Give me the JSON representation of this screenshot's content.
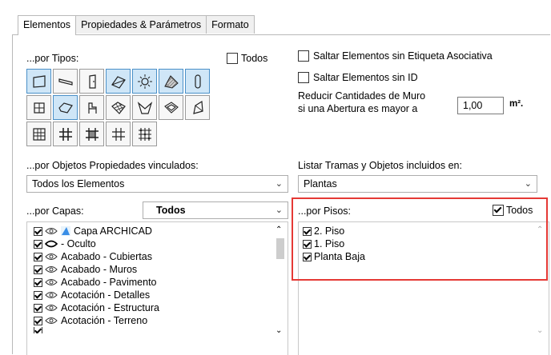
{
  "tabs": [
    "Elementos",
    "Propiedades & Parámetros",
    "Formato"
  ],
  "by_types": {
    "label": "...por Tipos:",
    "all_label": "Todos",
    "all_checked": false,
    "icons": [
      "wall-icon",
      "beam-icon",
      "door-icon",
      "slab-icon",
      "lamp-icon",
      "roof-icon",
      "column-icon",
      "window-icon",
      "shell-icon",
      "object-icon",
      "mesh-icon",
      "skylight-icon",
      "morph-icon",
      "railing-icon",
      "curtain-wall-icon",
      "grid-icon",
      "grid-panel-icon",
      "grid-frame-icon",
      "grid-junction-icon"
    ]
  },
  "options": {
    "skip_no_label": "Saltar Elementos sin Etiqueta Asociativa",
    "skip_no_id": "Saltar Elementos sin ID",
    "reduce_line1": "Reducir Cantidades de Muro",
    "reduce_line2": "si una Abertura es mayor a",
    "reduce_value": "1,00",
    "reduce_unit": "m²."
  },
  "by_properties": {
    "label": "...por Objetos Propiedades vinculados:",
    "value": "Todos los Elementos"
  },
  "list_in": {
    "label": "Listar Tramas y Objetos incluidos en:",
    "value": "Plantas"
  },
  "by_layers": {
    "label": "...por Capas:",
    "filter": "Todos",
    "items": [
      "Capa ARCHICAD",
      "- Oculto",
      "Acabado - Cubiertas",
      "Acabado - Muros",
      "Acabado - Pavimento",
      "Acotación - Detalles",
      "Acotación - Estructura",
      "Acotación - Terreno"
    ]
  },
  "by_floors": {
    "label": "...por Pisos:",
    "all_label": "Todos",
    "all_checked": true,
    "items": [
      "2. Piso",
      "1. Piso",
      "Planta Baja"
    ]
  },
  "colors": {
    "highlight": "#e53935",
    "selected_bg": "#cfe6f7"
  }
}
